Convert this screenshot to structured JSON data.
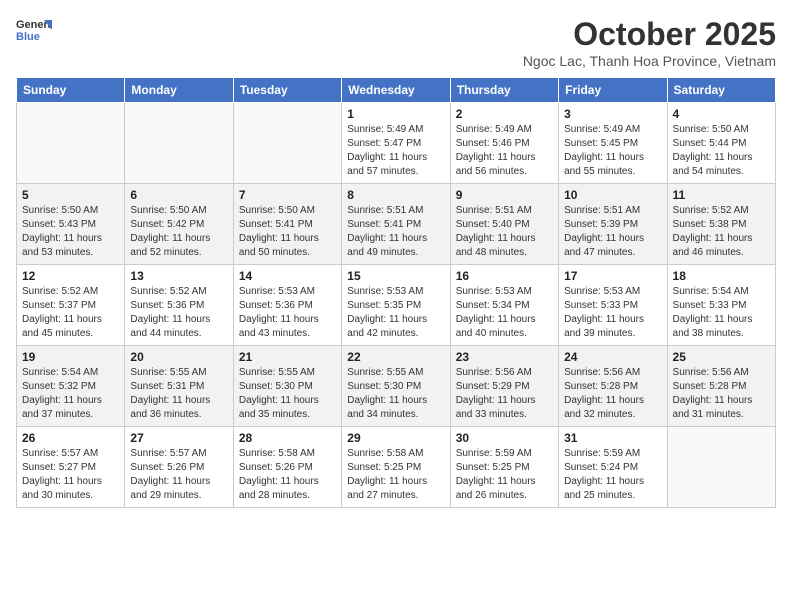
{
  "header": {
    "logo_line1": "General",
    "logo_line2": "Blue",
    "month": "October 2025",
    "location": "Ngoc Lac, Thanh Hoa Province, Vietnam"
  },
  "weekdays": [
    "Sunday",
    "Monday",
    "Tuesday",
    "Wednesday",
    "Thursday",
    "Friday",
    "Saturday"
  ],
  "weeks": [
    [
      {
        "day": "",
        "sunrise": "",
        "sunset": "",
        "daylight": ""
      },
      {
        "day": "",
        "sunrise": "",
        "sunset": "",
        "daylight": ""
      },
      {
        "day": "",
        "sunrise": "",
        "sunset": "",
        "daylight": ""
      },
      {
        "day": "1",
        "sunrise": "Sunrise: 5:49 AM",
        "sunset": "Sunset: 5:47 PM",
        "daylight": "Daylight: 11 hours and 57 minutes."
      },
      {
        "day": "2",
        "sunrise": "Sunrise: 5:49 AM",
        "sunset": "Sunset: 5:46 PM",
        "daylight": "Daylight: 11 hours and 56 minutes."
      },
      {
        "day": "3",
        "sunrise": "Sunrise: 5:49 AM",
        "sunset": "Sunset: 5:45 PM",
        "daylight": "Daylight: 11 hours and 55 minutes."
      },
      {
        "day": "4",
        "sunrise": "Sunrise: 5:50 AM",
        "sunset": "Sunset: 5:44 PM",
        "daylight": "Daylight: 11 hours and 54 minutes."
      }
    ],
    [
      {
        "day": "5",
        "sunrise": "Sunrise: 5:50 AM",
        "sunset": "Sunset: 5:43 PM",
        "daylight": "Daylight: 11 hours and 53 minutes."
      },
      {
        "day": "6",
        "sunrise": "Sunrise: 5:50 AM",
        "sunset": "Sunset: 5:42 PM",
        "daylight": "Daylight: 11 hours and 52 minutes."
      },
      {
        "day": "7",
        "sunrise": "Sunrise: 5:50 AM",
        "sunset": "Sunset: 5:41 PM",
        "daylight": "Daylight: 11 hours and 50 minutes."
      },
      {
        "day": "8",
        "sunrise": "Sunrise: 5:51 AM",
        "sunset": "Sunset: 5:41 PM",
        "daylight": "Daylight: 11 hours and 49 minutes."
      },
      {
        "day": "9",
        "sunrise": "Sunrise: 5:51 AM",
        "sunset": "Sunset: 5:40 PM",
        "daylight": "Daylight: 11 hours and 48 minutes."
      },
      {
        "day": "10",
        "sunrise": "Sunrise: 5:51 AM",
        "sunset": "Sunset: 5:39 PM",
        "daylight": "Daylight: 11 hours and 47 minutes."
      },
      {
        "day": "11",
        "sunrise": "Sunrise: 5:52 AM",
        "sunset": "Sunset: 5:38 PM",
        "daylight": "Daylight: 11 hours and 46 minutes."
      }
    ],
    [
      {
        "day": "12",
        "sunrise": "Sunrise: 5:52 AM",
        "sunset": "Sunset: 5:37 PM",
        "daylight": "Daylight: 11 hours and 45 minutes."
      },
      {
        "day": "13",
        "sunrise": "Sunrise: 5:52 AM",
        "sunset": "Sunset: 5:36 PM",
        "daylight": "Daylight: 11 hours and 44 minutes."
      },
      {
        "day": "14",
        "sunrise": "Sunrise: 5:53 AM",
        "sunset": "Sunset: 5:36 PM",
        "daylight": "Daylight: 11 hours and 43 minutes."
      },
      {
        "day": "15",
        "sunrise": "Sunrise: 5:53 AM",
        "sunset": "Sunset: 5:35 PM",
        "daylight": "Daylight: 11 hours and 42 minutes."
      },
      {
        "day": "16",
        "sunrise": "Sunrise: 5:53 AM",
        "sunset": "Sunset: 5:34 PM",
        "daylight": "Daylight: 11 hours and 40 minutes."
      },
      {
        "day": "17",
        "sunrise": "Sunrise: 5:53 AM",
        "sunset": "Sunset: 5:33 PM",
        "daylight": "Daylight: 11 hours and 39 minutes."
      },
      {
        "day": "18",
        "sunrise": "Sunrise: 5:54 AM",
        "sunset": "Sunset: 5:33 PM",
        "daylight": "Daylight: 11 hours and 38 minutes."
      }
    ],
    [
      {
        "day": "19",
        "sunrise": "Sunrise: 5:54 AM",
        "sunset": "Sunset: 5:32 PM",
        "daylight": "Daylight: 11 hours and 37 minutes."
      },
      {
        "day": "20",
        "sunrise": "Sunrise: 5:55 AM",
        "sunset": "Sunset: 5:31 PM",
        "daylight": "Daylight: 11 hours and 36 minutes."
      },
      {
        "day": "21",
        "sunrise": "Sunrise: 5:55 AM",
        "sunset": "Sunset: 5:30 PM",
        "daylight": "Daylight: 11 hours and 35 minutes."
      },
      {
        "day": "22",
        "sunrise": "Sunrise: 5:55 AM",
        "sunset": "Sunset: 5:30 PM",
        "daylight": "Daylight: 11 hours and 34 minutes."
      },
      {
        "day": "23",
        "sunrise": "Sunrise: 5:56 AM",
        "sunset": "Sunset: 5:29 PM",
        "daylight": "Daylight: 11 hours and 33 minutes."
      },
      {
        "day": "24",
        "sunrise": "Sunrise: 5:56 AM",
        "sunset": "Sunset: 5:28 PM",
        "daylight": "Daylight: 11 hours and 32 minutes."
      },
      {
        "day": "25",
        "sunrise": "Sunrise: 5:56 AM",
        "sunset": "Sunset: 5:28 PM",
        "daylight": "Daylight: 11 hours and 31 minutes."
      }
    ],
    [
      {
        "day": "26",
        "sunrise": "Sunrise: 5:57 AM",
        "sunset": "Sunset: 5:27 PM",
        "daylight": "Daylight: 11 hours and 30 minutes."
      },
      {
        "day": "27",
        "sunrise": "Sunrise: 5:57 AM",
        "sunset": "Sunset: 5:26 PM",
        "daylight": "Daylight: 11 hours and 29 minutes."
      },
      {
        "day": "28",
        "sunrise": "Sunrise: 5:58 AM",
        "sunset": "Sunset: 5:26 PM",
        "daylight": "Daylight: 11 hours and 28 minutes."
      },
      {
        "day": "29",
        "sunrise": "Sunrise: 5:58 AM",
        "sunset": "Sunset: 5:25 PM",
        "daylight": "Daylight: 11 hours and 27 minutes."
      },
      {
        "day": "30",
        "sunrise": "Sunrise: 5:59 AM",
        "sunset": "Sunset: 5:25 PM",
        "daylight": "Daylight: 11 hours and 26 minutes."
      },
      {
        "day": "31",
        "sunrise": "Sunrise: 5:59 AM",
        "sunset": "Sunset: 5:24 PM",
        "daylight": "Daylight: 11 hours and 25 minutes."
      },
      {
        "day": "",
        "sunrise": "",
        "sunset": "",
        "daylight": ""
      }
    ]
  ]
}
